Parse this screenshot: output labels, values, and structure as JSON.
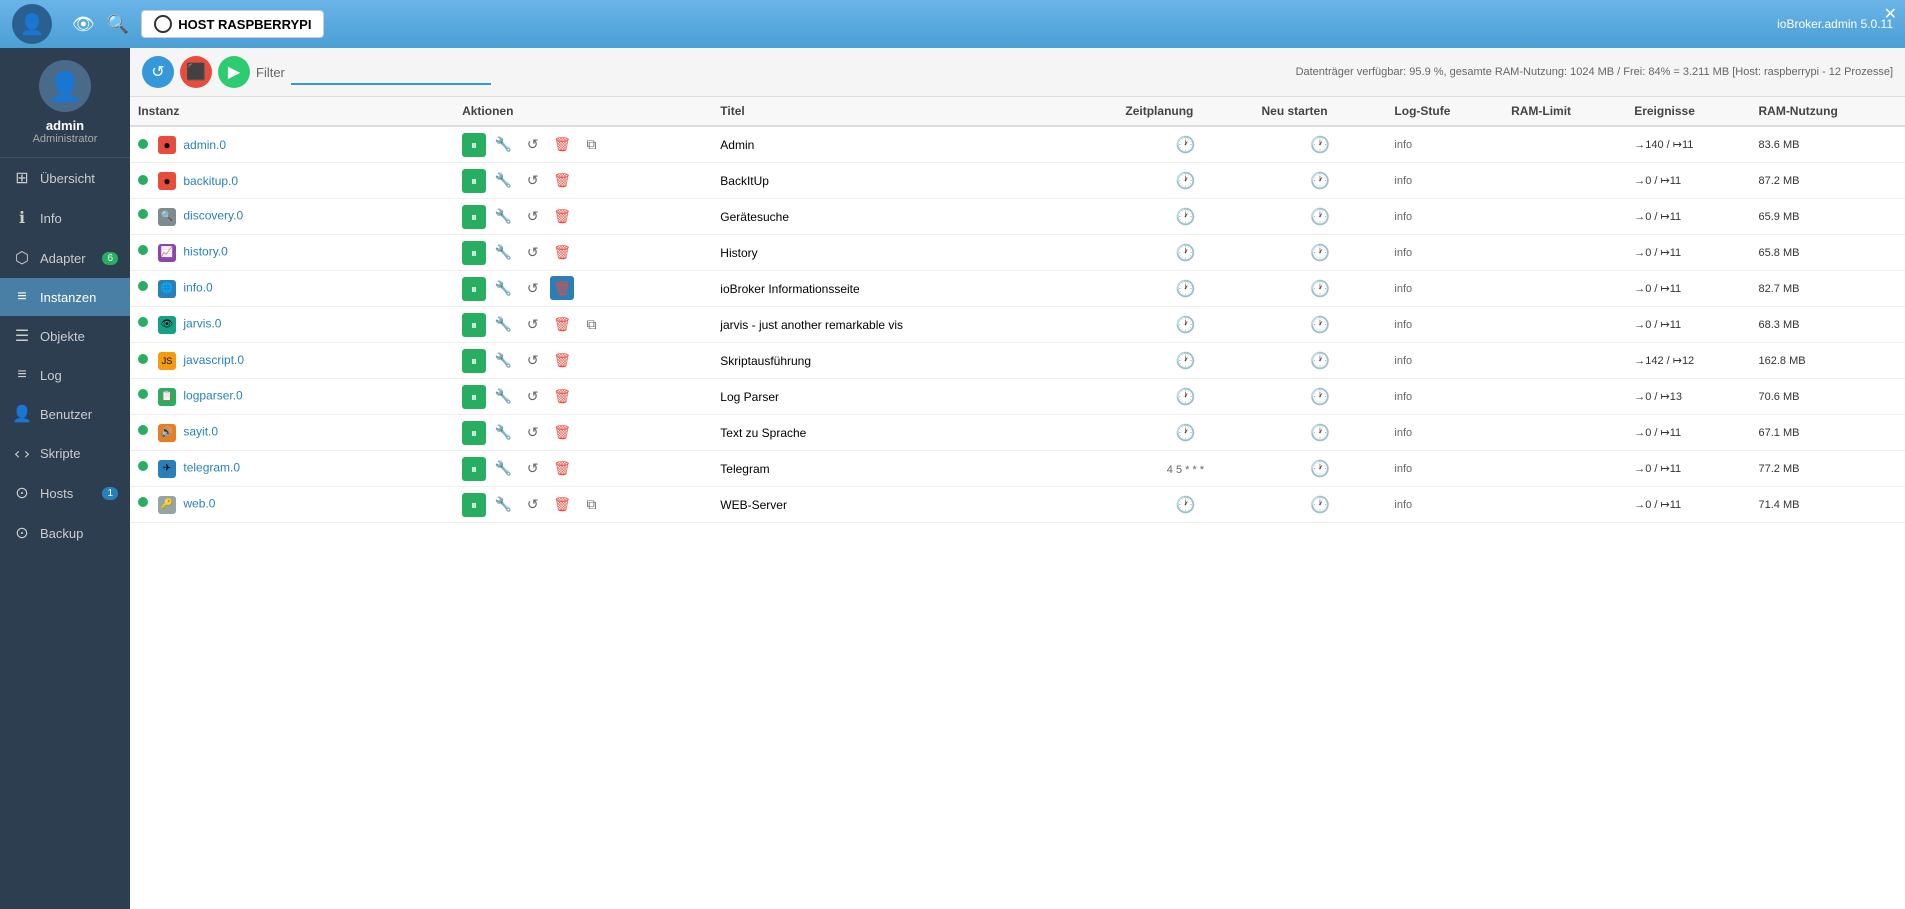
{
  "topbar": {
    "host_label": "HOST RASPBERRYPI",
    "user_right": "ioBroker.admin 5.0.11",
    "status_text": "Datenträger verfügbar: 95.9 %, gesamte RAM-Nutzung: 1024 MB / Frei: 84% = 3.211 MB [Host: raspberrypi - 12 Prozesse]"
  },
  "sidebar": {
    "username": "admin",
    "role": "Administrator",
    "items": [
      {
        "id": "uebersicht",
        "label": "Übersicht",
        "icon": "⊞",
        "badge": null,
        "active": false
      },
      {
        "id": "info",
        "label": "Info",
        "icon": "ℹ",
        "badge": null,
        "active": false
      },
      {
        "id": "adapter",
        "label": "Adapter",
        "icon": "⬡",
        "badge": "6",
        "badge_color": "green",
        "active": false
      },
      {
        "id": "instanzen",
        "label": "Instanzen",
        "icon": "≡",
        "badge": null,
        "active": true
      },
      {
        "id": "objekte",
        "label": "Objekte",
        "icon": "☰",
        "badge": null,
        "active": false
      },
      {
        "id": "log",
        "label": "Log",
        "icon": "≡",
        "badge": null,
        "active": false
      },
      {
        "id": "benutzer",
        "label": "Benutzer",
        "icon": "👤",
        "badge": null,
        "active": false
      },
      {
        "id": "skripte",
        "label": "Skripte",
        "icon": "‹›",
        "badge": null,
        "active": false
      },
      {
        "id": "hosts",
        "label": "Hosts",
        "icon": "⊙",
        "badge": "1",
        "badge_color": "blue",
        "active": false
      },
      {
        "id": "backup",
        "label": "Backup",
        "icon": "⊙",
        "badge": null,
        "active": false
      }
    ]
  },
  "toolbar": {
    "filter_placeholder": "Filter",
    "refresh_label": "↺",
    "stop_label": "⬛",
    "play_label": "▶"
  },
  "table": {
    "columns": [
      "Instanz",
      "Aktionen",
      "Titel",
      "Zeitplanung",
      "Neu starten",
      "Log-Stufe",
      "RAM-Limit",
      "Ereignisse",
      "RAM-Nutzung"
    ],
    "rows": [
      {
        "status": "green",
        "icon_type": "circle_red",
        "name": "admin.0",
        "title": "Admin",
        "schedule": "clock",
        "log_level": "info",
        "ram_limit": "",
        "events": "→140 / ↦11",
        "ram_usage": "83.6 MB",
        "has_link": true
      },
      {
        "status": "green",
        "icon_type": "circle_red",
        "name": "backitup.0",
        "title": "BackItUp",
        "schedule": "clock",
        "log_level": "info",
        "ram_limit": "",
        "events": "→0 / ↦11",
        "ram_usage": "87.2 MB",
        "has_link": false
      },
      {
        "status": "green",
        "icon_type": "circle_search",
        "name": "discovery.0",
        "title": "Gerätesuche",
        "schedule": "clock",
        "log_level": "info",
        "ram_limit": "",
        "events": "→0 / ↦11",
        "ram_usage": "65.9 MB",
        "has_link": false
      },
      {
        "status": "green",
        "icon_type": "circle_history",
        "name": "history.0",
        "title": "History",
        "schedule": "clock",
        "log_level": "info",
        "ram_limit": "",
        "events": "→0 / ↦11",
        "ram_usage": "65.8 MB",
        "has_link": false
      },
      {
        "status": "green",
        "icon_type": "circle_info",
        "name": "info.0",
        "title": "ioBroker Informationsseite",
        "schedule": "clock",
        "log_level": "info",
        "ram_limit": "",
        "events": "→0 / ↦11",
        "ram_usage": "82.7 MB",
        "has_link": false,
        "delete_active": true
      },
      {
        "status": "green",
        "icon_type": "circle_vis",
        "name": "jarvis.0",
        "title": "jarvis - just another remarkable vis",
        "schedule": "clock",
        "log_level": "info",
        "ram_limit": "",
        "events": "→0 / ↦11",
        "ram_usage": "68.3 MB",
        "has_link": true
      },
      {
        "status": "green",
        "icon_type": "circle_js",
        "name": "javascript.0",
        "title": "Skriptausführung",
        "schedule": "clock",
        "log_level": "info",
        "ram_limit": "",
        "events": "→142 / ↦12",
        "ram_usage": "162.8 MB",
        "has_link": false
      },
      {
        "status": "green",
        "icon_type": "circle_log",
        "name": "logparser.0",
        "title": "Log Parser",
        "schedule": "clock",
        "log_level": "info",
        "ram_limit": "",
        "events": "→0 / ↦13",
        "ram_usage": "70.6 MB",
        "has_link": false
      },
      {
        "status": "green",
        "icon_type": "circle_say",
        "name": "sayit.0",
        "title": "Text zu Sprache",
        "schedule": "clock",
        "log_level": "info",
        "ram_limit": "",
        "events": "→0 / ↦11",
        "ram_usage": "67.1 MB",
        "has_link": false
      },
      {
        "status": "green",
        "icon_type": "circle_telegram",
        "name": "telegram.0",
        "title": "Telegram",
        "schedule": "4 5 * * *",
        "log_level": "info",
        "ram_limit": "",
        "events": "→0 / ↦11",
        "ram_usage": "77.2 MB",
        "has_link": false
      },
      {
        "status": "green",
        "icon_type": "circle_web",
        "name": "web.0",
        "title": "WEB-Server",
        "schedule": "clock",
        "log_level": "info",
        "ram_limit": "",
        "events": "→0 / ↦11",
        "ram_usage": "71.4 MB",
        "has_link": true
      }
    ]
  },
  "icons": {
    "circle_red": "🔴",
    "circle_search": "🔍",
    "circle_history": "📈",
    "circle_info": "🌐",
    "circle_vis": "👁",
    "circle_js": "📜",
    "circle_log": "📋",
    "circle_say": "🔊",
    "circle_telegram": "✈",
    "circle_web": "🔑",
    "pause": "⏸",
    "wrench": "🔧",
    "refresh": "↺",
    "delete": "🗑",
    "link": "⧉",
    "clock": "🕐"
  }
}
